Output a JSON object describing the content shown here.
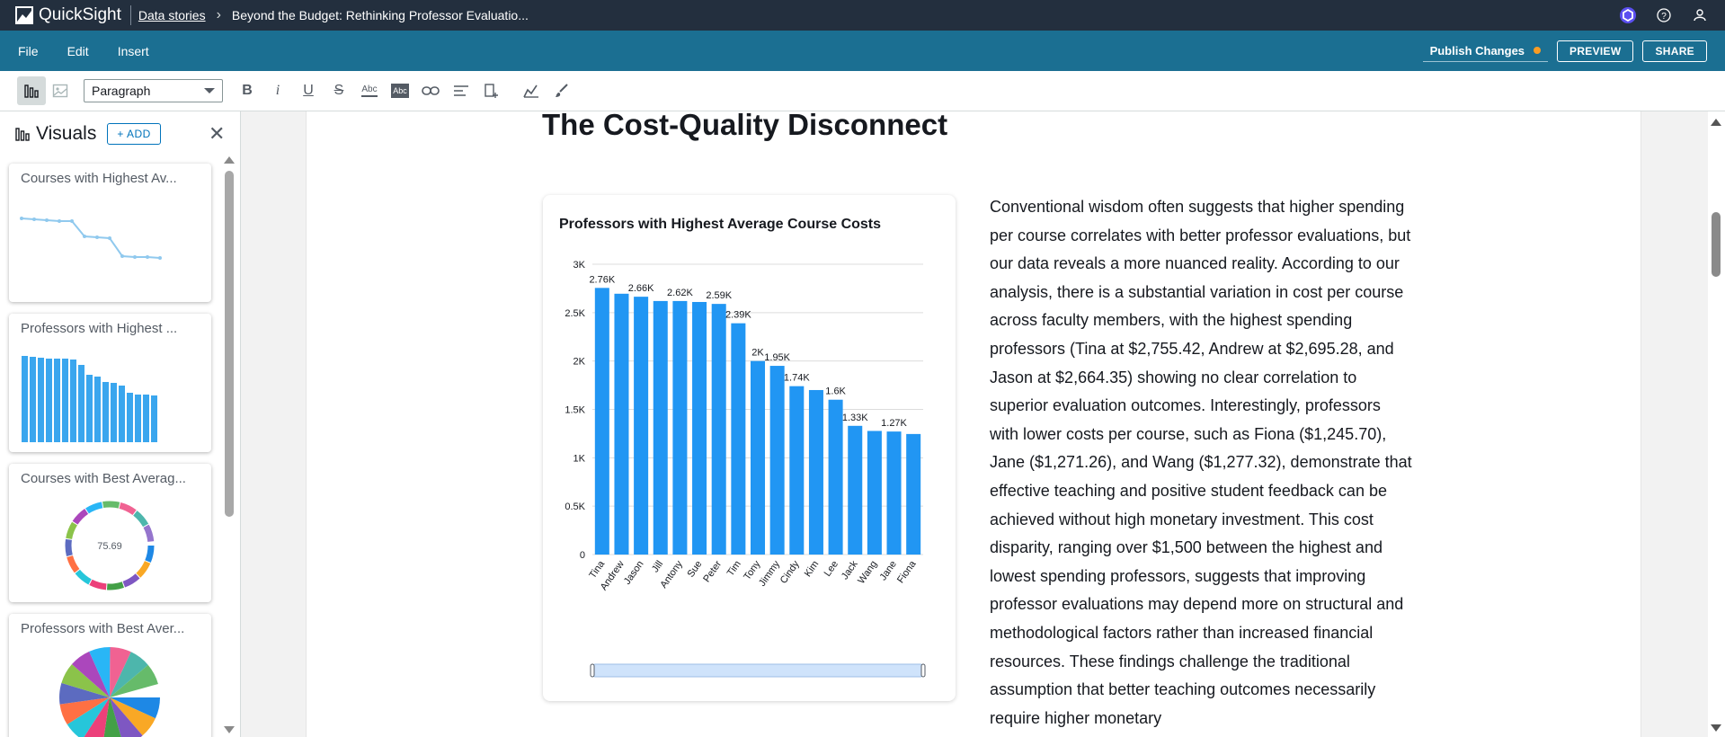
{
  "app": {
    "name": "QuickSight",
    "breadcrumb_link": "Data stories",
    "breadcrumb_title": "Beyond the Budget: Rethinking Professor Evaluatio..."
  },
  "menu": {
    "file": "File",
    "edit": "Edit",
    "insert": "Insert",
    "publish": "Publish Changes",
    "preview": "PREVIEW",
    "share": "SHARE"
  },
  "toolbar": {
    "style_select": "Paragraph",
    "strike_glyph": "S",
    "abc1": "Abc",
    "abc2": "Abc"
  },
  "visuals_panel": {
    "title": "Visuals",
    "add": "+ ADD",
    "cards": [
      {
        "title": "Courses with Highest Av..."
      },
      {
        "title": "Professors with Highest ..."
      },
      {
        "title": "Courses with Best Averag...",
        "donut_value": "75.69"
      },
      {
        "title": "Professors with Best Aver..."
      }
    ]
  },
  "story": {
    "heading": "The Cost-Quality Disconnect",
    "paragraph": "Conventional wisdom often suggests that higher spending per course correlates with better professor evaluations, but our data reveals a more nuanced reality. According to our analysis, there is a substantial variation in cost per course across faculty members, with the highest spending professors (Tina at $2,755.42, Andrew at $2,695.28, and Jason at $2,664.35) showing no clear correlation to superior evaluation outcomes. Interestingly, professors with lower costs per course, such as Fiona ($1,245.70), Jane ($1,271.26), and Wang ($1,277.32), demonstrate that effective teaching and positive student feedback can be achieved without high monetary investment. This cost disparity, ranging over $1,500 between the highest and lowest spending professors, suggests that improving professor evaluations may depend more on structural and methodological factors rather than increased financial resources. These findings challenge the traditional assumption that better teaching outcomes necessarily require higher monetary"
  },
  "colors": {
    "topbar": "#232f3e",
    "menubar": "#1b6f92",
    "bar": "#2196f3",
    "accent_dot": "#f89c24"
  },
  "chart_data": {
    "type": "bar",
    "title": "Professors with Highest Average Course Costs",
    "categories": [
      "Tina",
      "Andrew",
      "Jason",
      "Jill",
      "Antony",
      "Sue",
      "Peter",
      "Tim",
      "Tony",
      "Jimmy",
      "Cindy",
      "Kim",
      "Lee",
      "Jack",
      "Wang",
      "Jane",
      "Fiona"
    ],
    "values": [
      2755.42,
      2695.28,
      2664.35,
      2620,
      2620,
      2610,
      2590,
      2390,
      2000,
      1950,
      1740,
      1700,
      1600,
      1330,
      1277.32,
      1271.26,
      1245.7
    ],
    "data_labels": [
      "2.76K",
      "",
      "2.66K",
      "",
      "2.62K",
      "",
      "2.59K",
      "2.39K",
      "2K",
      "1.95K",
      "1.74K",
      "",
      "1.6K",
      "1.33K",
      "",
      "1.27K",
      ""
    ],
    "yticks": [
      "0",
      "0.5K",
      "1K",
      "1.5K",
      "2K",
      "2.5K",
      "3K"
    ],
    "ylim": [
      0,
      3000
    ],
    "grid": true
  }
}
